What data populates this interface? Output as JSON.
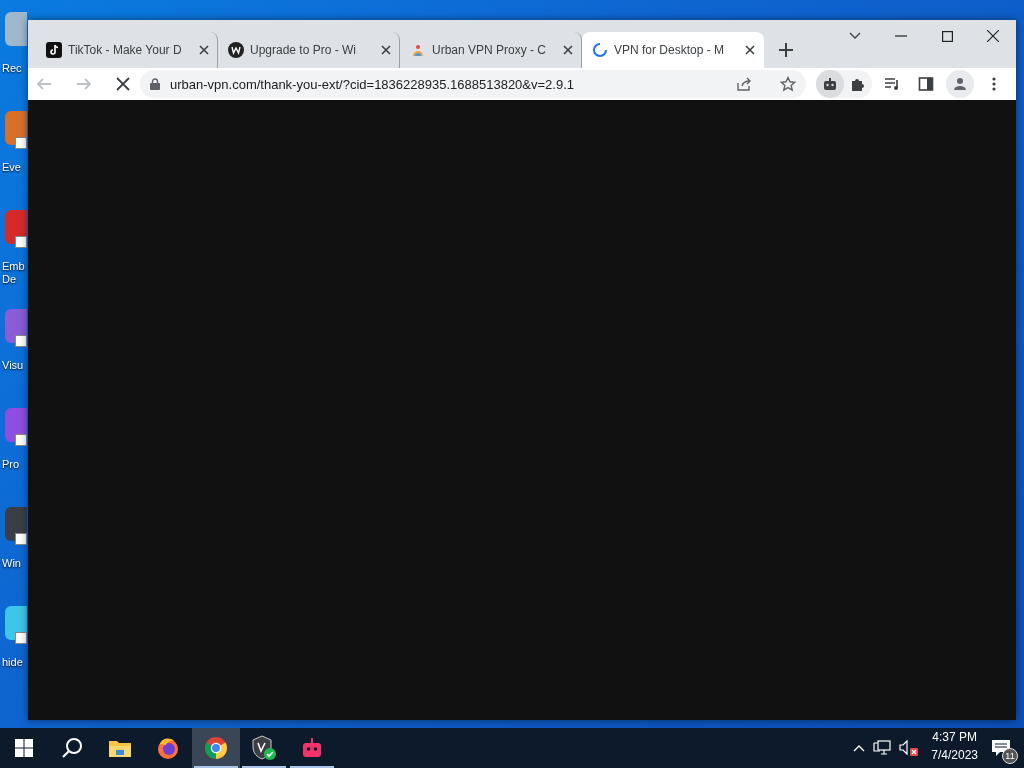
{
  "desktop": {
    "icons": [
      {
        "label": "Rec",
        "color": "#9fb8cc",
        "shortcut": false
      },
      {
        "label": "Eve",
        "color": "#d9702a",
        "shortcut": true
      },
      {
        "label": "Emb De",
        "color": "#d62a2a",
        "shortcut": true
      },
      {
        "label": "Visu",
        "color": "#8a5cd6",
        "shortcut": true
      },
      {
        "label": "Pro",
        "color": "#8e4fe0",
        "shortcut": true
      },
      {
        "label": "Win",
        "color": "#3a3f47",
        "shortcut": true
      },
      {
        "label": "hide",
        "color": "#3ec6e8",
        "shortcut": true
      }
    ]
  },
  "browser": {
    "tabs": [
      {
        "title": "TikTok - Make Your D",
        "kind": "tiktok",
        "selected": false,
        "loading": false
      },
      {
        "title": "Upgrade to Pro - Wi",
        "kind": "w",
        "selected": false,
        "loading": false
      },
      {
        "title": "Urban VPN Proxy - C",
        "kind": "urban",
        "selected": false,
        "loading": false
      },
      {
        "title": "VPN for Desktop - M",
        "selected": true,
        "loading": true
      }
    ],
    "url": "urban-vpn.com/thank-you-ext/?cid=1836228935.1688513820&v=2.9.1",
    "loading": true
  },
  "taskbar": {
    "apps": [
      {
        "kind": "explorer",
        "selected": false,
        "running": false
      },
      {
        "kind": "firefox",
        "selected": false,
        "running": false
      },
      {
        "kind": "chrome",
        "selected": true,
        "running": true
      },
      {
        "kind": "vpn",
        "selected": false,
        "running": true
      },
      {
        "kind": "robot",
        "selected": false,
        "running": true
      }
    ],
    "time": "4:37 PM",
    "date": "7/4/2023",
    "notifications": "11"
  }
}
